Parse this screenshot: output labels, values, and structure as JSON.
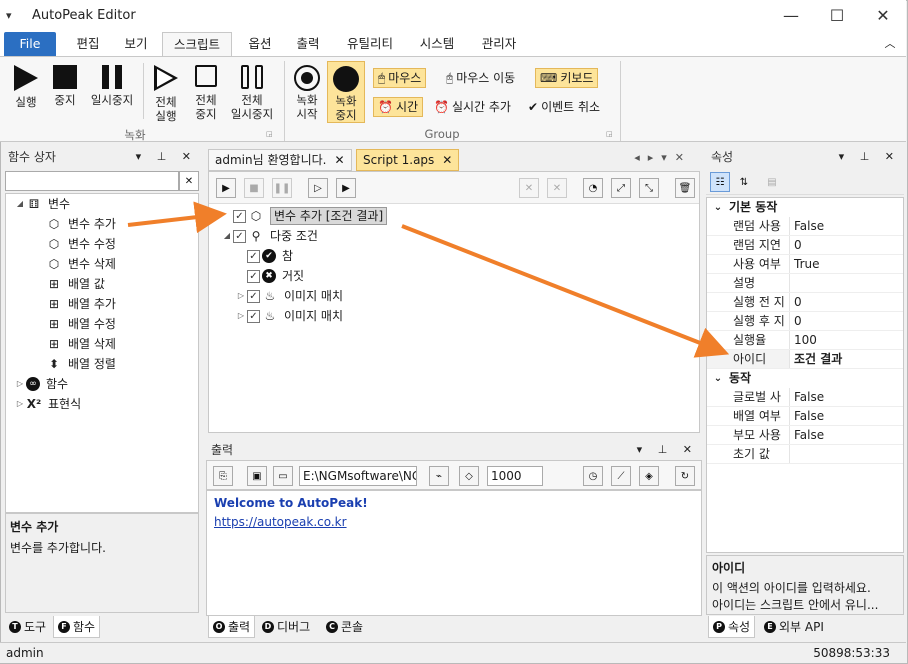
{
  "app": {
    "title": "AutoPeak Editor",
    "menu_glyph": "▾",
    "min": "—",
    "max": "☐",
    "close": "✕"
  },
  "menu": {
    "file": "File",
    "tabs": [
      "편집",
      "보기",
      "스크립트",
      "옵션",
      "출력",
      "유틸리티",
      "시스템",
      "관리자"
    ],
    "active": "스크립트",
    "collapse": "︿"
  },
  "ribbon": {
    "run": {
      "run": "실행",
      "stop": "중지",
      "pause": "일시중지",
      "run_all": [
        "전체",
        "실행"
      ],
      "stop_all": [
        "전체",
        "중지"
      ],
      "pause_all": [
        "전체",
        "일시중지"
      ]
    },
    "run_group": "녹화",
    "rec": {
      "start": [
        "녹화",
        "시작"
      ],
      "stop": [
        "녹화",
        "중지"
      ]
    },
    "options": {
      "mouse": "마우스",
      "mouse_move": "마우스 이동",
      "keyboard": "키보드",
      "time": "시간",
      "realtime": "실시간 추가",
      "event_cancel": "이벤트 취소"
    },
    "group_label": "Group"
  },
  "left_panel": {
    "title": "함수 상자",
    "search": "",
    "tree": [
      {
        "label": "변수",
        "level": 0,
        "exp": "◢",
        "icon": "var"
      },
      {
        "label": "변수 추가",
        "level": 1,
        "icon": "cube"
      },
      {
        "label": "변수 수정",
        "level": 1,
        "icon": "cube"
      },
      {
        "label": "변수 삭제",
        "level": 1,
        "icon": "cube"
      },
      {
        "label": "배열 값",
        "level": 1,
        "icon": "arr"
      },
      {
        "label": "배열 추가",
        "level": 1,
        "icon": "arr"
      },
      {
        "label": "배열 수정",
        "level": 1,
        "icon": "arr"
      },
      {
        "label": "배열 삭제",
        "level": 1,
        "icon": "arr"
      },
      {
        "label": "배열 정렬",
        "level": 1,
        "icon": "sort"
      },
      {
        "label": "함수",
        "level": 0,
        "exp": "▷",
        "icon": "func"
      },
      {
        "label": "표현식",
        "level": 0,
        "exp": "▷",
        "icon": "expr"
      }
    ],
    "desc_title": "변수 추가",
    "desc_text": "변수를 추가합니다.",
    "tabs": [
      {
        "c": "T",
        "label": "도구"
      },
      {
        "c": "F",
        "label": "함수"
      }
    ]
  },
  "doc_tabs": [
    {
      "label": "admin님 환영합니다."
    },
    {
      "label": "Script 1.aps"
    }
  ],
  "script_tree": [
    {
      "label": "변수 추가 [조건 결과]",
      "level": 0,
      "exp": "",
      "icon": "cube",
      "selected": true
    },
    {
      "label": "다중 조건",
      "level": 0,
      "exp": "◢",
      "icon": "multi"
    },
    {
      "label": "참",
      "level": 1,
      "exp": "",
      "icon": "true"
    },
    {
      "label": "거짓",
      "level": 1,
      "exp": "",
      "icon": "false"
    },
    {
      "label": "이미지 매치",
      "level": 1,
      "exp": "▷",
      "icon": "img"
    },
    {
      "label": "이미지 매치",
      "level": 1,
      "exp": "▷",
      "icon": "img"
    }
  ],
  "output": {
    "title": "출력",
    "path": "E:\\NGMsoftware\\NG",
    "count": "1000",
    "lines": [
      {
        "text": "Welcome to AutoPeak!",
        "bold": true
      },
      {
        "text": "https://autopeak.co.kr",
        "link": true
      }
    ],
    "tabs": [
      {
        "c": "O",
        "label": "출력"
      },
      {
        "c": "D",
        "label": "디버그"
      },
      {
        "c": "C",
        "label": "콘솔"
      }
    ]
  },
  "props": {
    "title": "속성",
    "cat1": "기본 동작",
    "rows1": [
      {
        "k": "랜덤 사용",
        "v": "False"
      },
      {
        "k": "랜덤 지연",
        "v": "0"
      },
      {
        "k": "사용 여부",
        "v": "True"
      },
      {
        "k": "설명",
        "v": ""
      },
      {
        "k": "실행 전 지",
        "v": "0"
      },
      {
        "k": "실행 후 지",
        "v": "0"
      },
      {
        "k": "실행율",
        "v": "100"
      },
      {
        "k": "아이디",
        "v": "조건 결과"
      }
    ],
    "cat2": "동작",
    "rows2": [
      {
        "k": "글로벌 사",
        "v": "False"
      },
      {
        "k": "배열 여부",
        "v": "False"
      },
      {
        "k": "부모 사용",
        "v": "False"
      },
      {
        "k": "초기 값",
        "v": ""
      }
    ],
    "desc_title": "아이디",
    "desc_lines": [
      "이 액션의 아이디를 입력하세요.",
      "아이디는 스크립트 안에서 유니..."
    ],
    "tabs": [
      {
        "c": "P",
        "label": "속성"
      },
      {
        "c": "E",
        "label": "외부 API"
      }
    ]
  },
  "status": {
    "user": "admin",
    "time": "50898:53:33"
  },
  "colors": {
    "accent": "#2b6fc2",
    "highlight": "#fde49a",
    "arrow": "#f07f2a",
    "link": "#1a3fb0"
  }
}
